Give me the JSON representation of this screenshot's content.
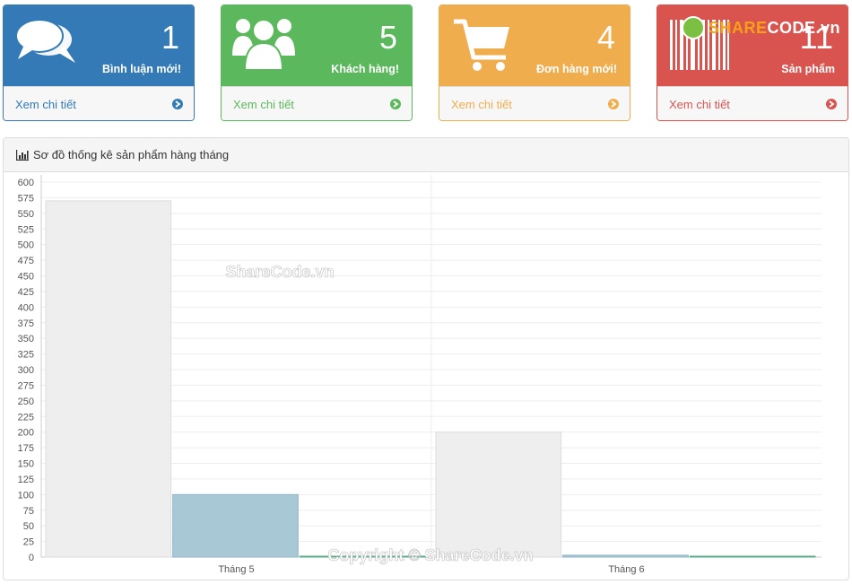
{
  "cards": [
    {
      "id": "comments",
      "number": "1",
      "label": "Bình luận mới!",
      "link": "Xem chi tiết",
      "icon": "comments-icon",
      "color": "#337ab7"
    },
    {
      "id": "customers",
      "number": "5",
      "label": "Khách hàng!",
      "link": "Xem chi tiết",
      "icon": "users-icon",
      "color": "#5cb85c"
    },
    {
      "id": "orders",
      "number": "4",
      "label": "Đơn hàng mới!",
      "link": "Xem chi tiết",
      "icon": "shopping-cart-icon",
      "color": "#f0ad4e"
    },
    {
      "id": "products",
      "number": "11",
      "label": "Sản phẩm",
      "link": "Xem chi tiết",
      "icon": "barcode-icon",
      "color": "#d9534f"
    }
  ],
  "panel": {
    "title": "Sơ đồ thống kê sản phẩm hàng tháng",
    "icon": "bar-chart-icon"
  },
  "watermarks": {
    "logo_a": "SHARE",
    "logo_b": "CODE.vn",
    "center": "ShareCode.vn",
    "bottom": "Copyright © ShareCode.vn"
  },
  "chart_data": {
    "type": "bar",
    "categories": [
      "Tháng 5",
      "Tháng 6"
    ],
    "series": [
      {
        "values": [
          570,
          200
        ],
        "color": "#eeeeee",
        "stroke": "#dddddd"
      },
      {
        "values": [
          100,
          3
        ],
        "color": "#a9c8d6",
        "stroke": "#8fb5c7"
      },
      {
        "values": [
          1,
          1
        ],
        "color": "#7fc5a8",
        "stroke": "#5aab8a"
      }
    ],
    "ylim": [
      0,
      600
    ],
    "yticks": [
      0,
      25,
      50,
      75,
      100,
      125,
      150,
      175,
      200,
      225,
      250,
      275,
      300,
      325,
      350,
      375,
      400,
      425,
      450,
      475,
      500,
      525,
      550,
      575,
      600
    ],
    "grid": true
  }
}
